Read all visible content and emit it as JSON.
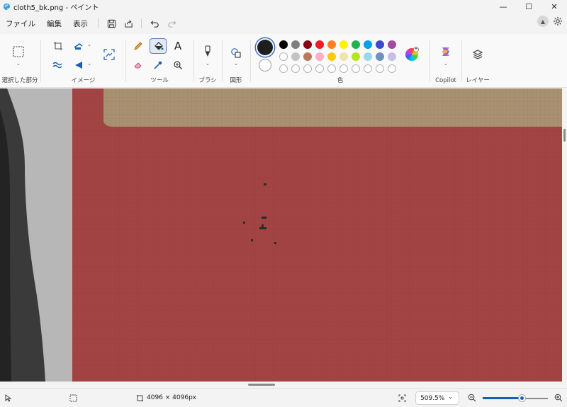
{
  "window": {
    "title": "cloth5_bk.png - ペイント",
    "minimize_glyph": "—",
    "maximize_glyph": "☐",
    "close_glyph": "✕"
  },
  "menu": {
    "file": "ファイル",
    "edit": "編集",
    "view": "表示"
  },
  "ribbon": {
    "selection_label": "選択した部分",
    "image_label": "イメージ",
    "tools_label": "ツール",
    "brushes_label": "ブラシ",
    "shapes_label": "図形",
    "colors_label": "色",
    "copilot_label": "Copilot",
    "layers_label": "レイヤー",
    "text_tool_glyph": "A",
    "palette_row1": [
      "#000000",
      "#7f7f7f",
      "#880015",
      "#ed1c24",
      "#ff7f27",
      "#fff200",
      "#22b14c",
      "#00a2e8",
      "#3f48cc",
      "#a349a4"
    ],
    "palette_row2": [
      "#ffffff",
      "#c3c3c3",
      "#b97a57",
      "#ffaec9",
      "#ffc90e",
      "#efe4b0",
      "#b5e61d",
      "#99d9ea",
      "#7092be",
      "#c8bfe7"
    ],
    "primary_color": "#1e1e1e",
    "secondary_color": "#ffffff"
  },
  "canvas": {
    "background_red": "#a24444",
    "band_tan": "#a89070",
    "left_gray": "#b7b7b7",
    "dark_edge": "#3a3a3a"
  },
  "status": {
    "image_size": "4096 × 4096px",
    "zoom": "509.5%",
    "zoom_level_fraction": 0.6
  }
}
